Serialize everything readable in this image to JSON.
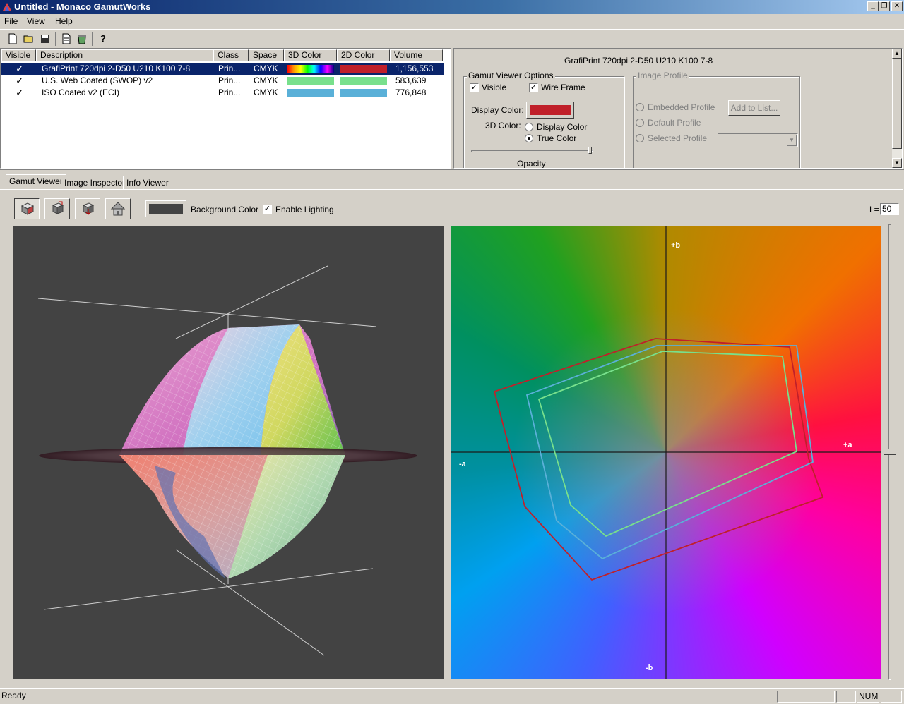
{
  "window": {
    "title": "Untitled - Monaco GamutWorks",
    "controls": {
      "minimize": "_",
      "restore": "❐",
      "close": "✕"
    }
  },
  "menu": {
    "items": [
      "File",
      "View",
      "Help"
    ]
  },
  "toolbar": {
    "buttons": [
      "new-file-icon",
      "open-folder-icon",
      "save-icon",
      "document-icon",
      "recycle-icon",
      "help-icon"
    ]
  },
  "profile_list": {
    "columns": [
      "Visible",
      "Description",
      "Class",
      "Space",
      "3D Color",
      "2D Color",
      "Volume"
    ],
    "rows": [
      {
        "visible": "✓",
        "description": "GrafiPrint 720dpi 2-D50 U210 K100 7-8",
        "class": "Prin...",
        "space": "CMYK",
        "color3d": "rainbow",
        "color2d": "#c0202a",
        "volume": "1,156,553",
        "selected": true
      },
      {
        "visible": "✓",
        "description": "U.S. Web Coated (SWOP) v2",
        "class": "Prin...",
        "space": "CMYK",
        "color3d": "#78e08c",
        "color2d": "#78e08c",
        "volume": "583,639",
        "selected": false
      },
      {
        "visible": "✓",
        "description": "ISO Coated v2 (ECI)",
        "class": "Prin...",
        "space": "CMYK",
        "color3d": "#5ab0d8",
        "color2d": "#5ab0d8",
        "volume": "776,848",
        "selected": false
      }
    ]
  },
  "options": {
    "profile_name": "GrafiPrint 720dpi 2-D50 U210 K100 7-8",
    "gamut_viewer_options_label": "Gamut Viewer Options",
    "visible_label": "Visible",
    "wireframe_label": "Wire Frame",
    "display_color_label": "Display Color:",
    "display_color": "#c0202a",
    "color3d_label": "3D Color:",
    "display_color_option": "Display Color",
    "true_color_option": "True Color",
    "opacity_label": "Opacity",
    "opacity_value": 0.97,
    "image_profile_label": "Image Profile",
    "embedded_profile_label": "Embedded Profile",
    "add_to_list_label": "Add to List...",
    "default_profile_label": "Default Profile",
    "selected_profile_label": "Selected Profile"
  },
  "tabs": [
    "Gamut Viewer",
    "Image Inspector",
    "Info Viewer"
  ],
  "viewer": {
    "tool_icons": [
      "cube-icon",
      "rotate-cube-icon",
      "reset-cube-icon",
      "home-icon"
    ],
    "background_color_label": "Background Color",
    "background_color": "#434343",
    "enable_lighting_label": "Enable Lighting",
    "l_label": "L=",
    "l_value": "50",
    "axis_labels": {
      "plus_b": "+b",
      "minus_b": "-b",
      "plus_a": "+a",
      "minus_a": "-a"
    }
  },
  "status": {
    "text": "Ready",
    "num": "NUM"
  }
}
